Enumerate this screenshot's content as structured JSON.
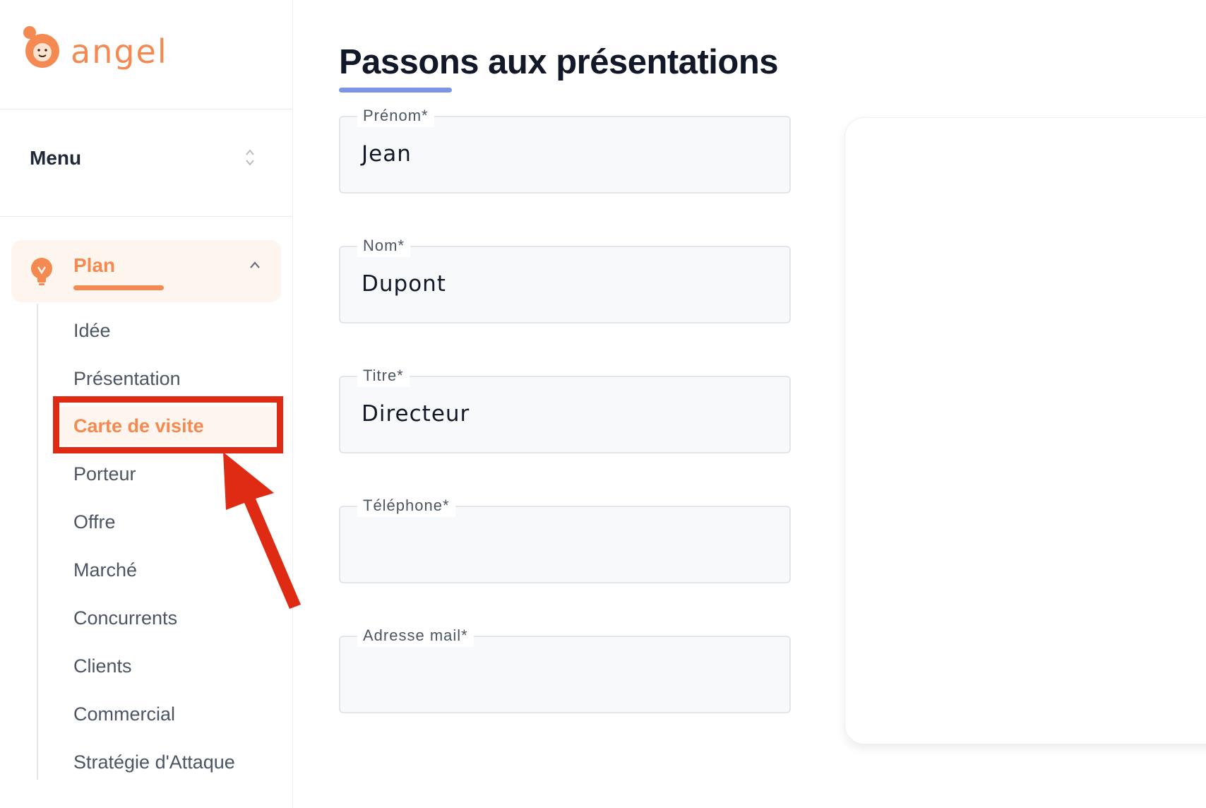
{
  "app": {
    "logo_text": "angel"
  },
  "sidebar": {
    "menu_label": "Menu",
    "plan_label": "Plan",
    "items": [
      {
        "label": "Idée"
      },
      {
        "label": "Présentation"
      },
      {
        "label": "Carte de visite"
      },
      {
        "label": "Porteur"
      },
      {
        "label": "Offre"
      },
      {
        "label": "Marché"
      },
      {
        "label": "Concurrents"
      },
      {
        "label": "Clients"
      },
      {
        "label": "Commercial"
      },
      {
        "label": "Stratégie d'Attaque"
      }
    ],
    "active_item": "Carte de visite"
  },
  "main": {
    "title": "Passons aux présentations",
    "fields": [
      {
        "label": "Prénom*",
        "value": "Jean"
      },
      {
        "label": "Nom*",
        "value": "Dupont"
      },
      {
        "label": "Titre*",
        "value": "Directeur"
      },
      {
        "label": "Téléphone*",
        "value": ""
      },
      {
        "label": "Adresse mail*",
        "value": ""
      }
    ]
  },
  "colors": {
    "accent": "#f48a52",
    "accent_bg": "#fef5ee",
    "title_underline": "#7c93e6",
    "annotation_red": "#e02b14"
  },
  "icons": [
    "angel-logo-icon",
    "sort-updown-icon",
    "lightbulb-icon",
    "chevron-up-icon",
    "annotation-arrow-icon"
  ]
}
